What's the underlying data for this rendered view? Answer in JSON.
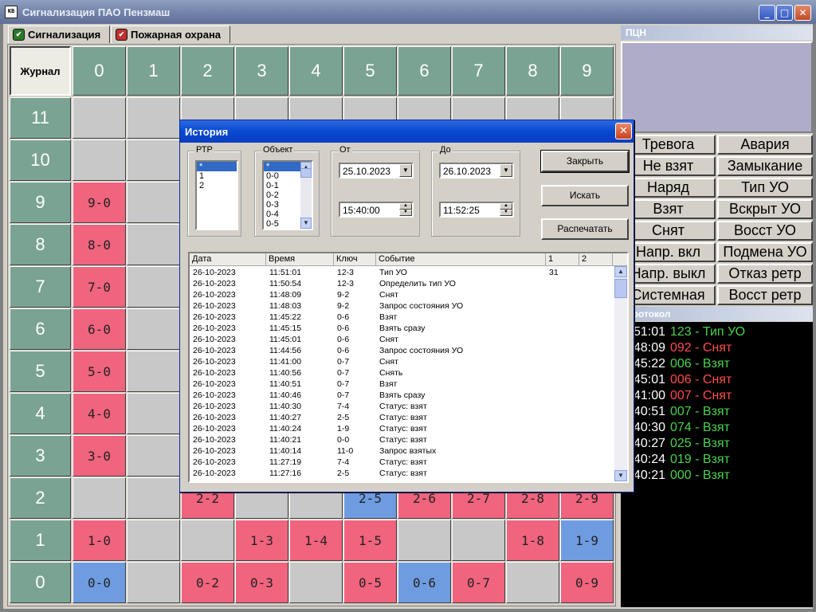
{
  "window": {
    "title": "Сигнализация ПАО Пензмаш",
    "icon_label": "KB"
  },
  "tabs": [
    {
      "label": "Сигнализация",
      "active": true
    },
    {
      "label": "Пожарная охрана",
      "active": false
    }
  ],
  "grid": {
    "corner_label": "Журнал",
    "col_headers": [
      "0",
      "1",
      "2",
      "3",
      "4",
      "5",
      "6",
      "7",
      "8",
      "9"
    ],
    "rows": [
      {
        "label": "11",
        "cells": [
          {
            "s": "gray",
            "t": ""
          },
          {
            "s": "gray",
            "t": ""
          },
          {
            "s": "gray",
            "t": ""
          },
          {
            "s": "gray",
            "t": ""
          },
          {
            "s": "gray",
            "t": ""
          },
          {
            "s": "gray",
            "t": ""
          },
          {
            "s": "gray",
            "t": ""
          },
          {
            "s": "gray",
            "t": ""
          },
          {
            "s": "gray",
            "t": ""
          },
          {
            "s": "gray",
            "t": ""
          }
        ]
      },
      {
        "label": "10",
        "cells": [
          {
            "s": "gray",
            "t": ""
          },
          {
            "s": "gray",
            "t": ""
          },
          {
            "s": "gray",
            "t": ""
          },
          {
            "s": "gray",
            "t": ""
          },
          {
            "s": "gray",
            "t": ""
          },
          {
            "s": "gray",
            "t": ""
          },
          {
            "s": "gray",
            "t": ""
          },
          {
            "s": "gray",
            "t": ""
          },
          {
            "s": "gray",
            "t": ""
          },
          {
            "s": "gray",
            "t": ""
          }
        ]
      },
      {
        "label": "9",
        "cells": [
          {
            "s": "red",
            "t": "9-0"
          },
          {
            "s": "gray",
            "t": ""
          },
          {
            "s": "gray",
            "t": ""
          },
          {
            "s": "gray",
            "t": ""
          },
          {
            "s": "gray",
            "t": ""
          },
          {
            "s": "gray",
            "t": ""
          },
          {
            "s": "gray",
            "t": ""
          },
          {
            "s": "gray",
            "t": ""
          },
          {
            "s": "gray",
            "t": ""
          },
          {
            "s": "gray",
            "t": ""
          }
        ]
      },
      {
        "label": "8",
        "cells": [
          {
            "s": "red",
            "t": "8-0"
          },
          {
            "s": "gray",
            "t": ""
          },
          {
            "s": "gray",
            "t": ""
          },
          {
            "s": "gray",
            "t": ""
          },
          {
            "s": "gray",
            "t": ""
          },
          {
            "s": "gray",
            "t": ""
          },
          {
            "s": "gray",
            "t": ""
          },
          {
            "s": "gray",
            "t": ""
          },
          {
            "s": "gray",
            "t": ""
          },
          {
            "s": "gray",
            "t": ""
          }
        ]
      },
      {
        "label": "7",
        "cells": [
          {
            "s": "red",
            "t": "7-0"
          },
          {
            "s": "gray",
            "t": ""
          },
          {
            "s": "gray",
            "t": ""
          },
          {
            "s": "gray",
            "t": ""
          },
          {
            "s": "gray",
            "t": ""
          },
          {
            "s": "gray",
            "t": ""
          },
          {
            "s": "gray",
            "t": ""
          },
          {
            "s": "gray",
            "t": ""
          },
          {
            "s": "gray",
            "t": ""
          },
          {
            "s": "gray",
            "t": ""
          }
        ]
      },
      {
        "label": "6",
        "cells": [
          {
            "s": "red",
            "t": "6-0"
          },
          {
            "s": "gray",
            "t": ""
          },
          {
            "s": "gray",
            "t": ""
          },
          {
            "s": "gray",
            "t": ""
          },
          {
            "s": "gray",
            "t": ""
          },
          {
            "s": "gray",
            "t": ""
          },
          {
            "s": "gray",
            "t": ""
          },
          {
            "s": "gray",
            "t": ""
          },
          {
            "s": "gray",
            "t": ""
          },
          {
            "s": "gray",
            "t": ""
          }
        ]
      },
      {
        "label": "5",
        "cells": [
          {
            "s": "red",
            "t": "5-0"
          },
          {
            "s": "gray",
            "t": ""
          },
          {
            "s": "gray",
            "t": ""
          },
          {
            "s": "gray",
            "t": ""
          },
          {
            "s": "gray",
            "t": ""
          },
          {
            "s": "gray",
            "t": ""
          },
          {
            "s": "gray",
            "t": ""
          },
          {
            "s": "gray",
            "t": ""
          },
          {
            "s": "gray",
            "t": ""
          },
          {
            "s": "gray",
            "t": ""
          }
        ]
      },
      {
        "label": "4",
        "cells": [
          {
            "s": "red",
            "t": "4-0"
          },
          {
            "s": "gray",
            "t": ""
          },
          {
            "s": "gray",
            "t": ""
          },
          {
            "s": "gray",
            "t": ""
          },
          {
            "s": "gray",
            "t": ""
          },
          {
            "s": "gray",
            "t": ""
          },
          {
            "s": "gray",
            "t": ""
          },
          {
            "s": "gray",
            "t": ""
          },
          {
            "s": "gray",
            "t": ""
          },
          {
            "s": "gray",
            "t": ""
          }
        ]
      },
      {
        "label": "3",
        "cells": [
          {
            "s": "red",
            "t": "3-0"
          },
          {
            "s": "gray",
            "t": ""
          },
          {
            "s": "gray",
            "t": ""
          },
          {
            "s": "gray",
            "t": ""
          },
          {
            "s": "gray",
            "t": ""
          },
          {
            "s": "gray",
            "t": ""
          },
          {
            "s": "gray",
            "t": ""
          },
          {
            "s": "gray",
            "t": ""
          },
          {
            "s": "gray",
            "t": ""
          },
          {
            "s": "gray",
            "t": ""
          }
        ]
      },
      {
        "label": "2",
        "cells": [
          {
            "s": "gray",
            "t": ""
          },
          {
            "s": "gray",
            "t": ""
          },
          {
            "s": "red",
            "t": "2-2"
          },
          {
            "s": "gray",
            "t": ""
          },
          {
            "s": "gray",
            "t": ""
          },
          {
            "s": "blue",
            "t": "2-5"
          },
          {
            "s": "red",
            "t": "2-6"
          },
          {
            "s": "red",
            "t": "2-7"
          },
          {
            "s": "red",
            "t": "2-8"
          },
          {
            "s": "red",
            "t": "2-9"
          }
        ]
      },
      {
        "label": "1",
        "cells": [
          {
            "s": "red",
            "t": "1-0"
          },
          {
            "s": "gray",
            "t": ""
          },
          {
            "s": "gray",
            "t": ""
          },
          {
            "s": "red",
            "t": "1-3"
          },
          {
            "s": "red",
            "t": "1-4"
          },
          {
            "s": "red",
            "t": "1-5"
          },
          {
            "s": "gray",
            "t": ""
          },
          {
            "s": "gray",
            "t": ""
          },
          {
            "s": "red",
            "t": "1-8"
          },
          {
            "s": "blue",
            "t": "1-9"
          }
        ]
      },
      {
        "label": "0",
        "cells": [
          {
            "s": "blue",
            "t": "0-0"
          },
          {
            "s": "gray",
            "t": ""
          },
          {
            "s": "red",
            "t": "0-2"
          },
          {
            "s": "red",
            "t": "0-3"
          },
          {
            "s": "gray",
            "t": ""
          },
          {
            "s": "red",
            "t": "0-5"
          },
          {
            "s": "blue",
            "t": "0-6"
          },
          {
            "s": "red",
            "t": "0-7"
          },
          {
            "s": "gray",
            "t": ""
          },
          {
            "s": "red",
            "t": "0-9"
          }
        ]
      }
    ]
  },
  "pcn": {
    "title": "ПЦН"
  },
  "status_buttons": [
    "Тревога",
    "Авария",
    "Не взят",
    "Замыкание",
    "Наряд",
    "Тип УО",
    "Взят",
    "Вскрыт УО",
    "Снят",
    "Восст УО",
    "Напр. вкл",
    "Подмена УО",
    "Напр. выкл",
    "Отказ ретр",
    "Системная",
    "Восст ретр"
  ],
  "protocol": {
    "title": "Протокол",
    "lines": [
      {
        "time": "11:51:01",
        "text": "123 - Тип УО",
        "color": "green"
      },
      {
        "time": "11:48:09",
        "text": "092 - Снят",
        "color": "red"
      },
      {
        "time": "11:45:22",
        "text": "006 - Взят",
        "color": "green"
      },
      {
        "time": "11:45:01",
        "text": "006 - Снят",
        "color": "red"
      },
      {
        "time": "11:41:00",
        "text": "007 - Снят",
        "color": "red"
      },
      {
        "time": "11:40:51",
        "text": "007 - Взят",
        "color": "green"
      },
      {
        "time": "11:40:30",
        "text": "074 - Взят",
        "color": "green"
      },
      {
        "time": "11:40:27",
        "text": "025 - Взят",
        "color": "green"
      },
      {
        "time": "11:40:24",
        "text": "019 - Взят",
        "color": "green"
      },
      {
        "time": "11:40:21",
        "text": "000 - Взят",
        "color": "green"
      }
    ]
  },
  "dialog": {
    "title": "История",
    "rtr": {
      "label": "РТР",
      "items": [
        "*",
        "1",
        "2"
      ],
      "selected": 0
    },
    "object": {
      "label": "Объект",
      "items": [
        "*",
        "0-0",
        "0-1",
        "0-2",
        "0-3",
        "0-4",
        "0-5"
      ],
      "selected": 0
    },
    "from": {
      "label": "От",
      "date": "25.10.2023",
      "time": "15:40:00"
    },
    "to": {
      "label": "До",
      "date": "26.10.2023",
      "time": "11:52:25"
    },
    "buttons": {
      "close": "Закрыть",
      "search": "Искать",
      "print": "Распечатать"
    },
    "columns": [
      "Дата",
      "Время",
      "Ключ",
      "Событие",
      "1",
      "2"
    ],
    "rows": [
      [
        "26-10-2023",
        "11:51:01",
        "12-3",
        "Тип УО",
        "31",
        ""
      ],
      [
        "26-10-2023",
        "11:50:54",
        "12-3",
        "Определить тип УО",
        "",
        ""
      ],
      [
        "26-10-2023",
        "11:48:09",
        "9-2",
        "Снят",
        "",
        ""
      ],
      [
        "26-10-2023",
        "11:48:03",
        "9-2",
        "Запрос состояния УО",
        "",
        ""
      ],
      [
        "26-10-2023",
        "11:45:22",
        "0-6",
        "Взят",
        "",
        ""
      ],
      [
        "26-10-2023",
        "11:45:15",
        "0-6",
        "Взять сразу",
        "",
        ""
      ],
      [
        "26-10-2023",
        "11:45:01",
        "0-6",
        "Снят",
        "",
        ""
      ],
      [
        "26-10-2023",
        "11:44:56",
        "0-6",
        "Запрос состояния УО",
        "",
        ""
      ],
      [
        "26-10-2023",
        "11:41:00",
        "0-7",
        "Снят",
        "",
        ""
      ],
      [
        "26-10-2023",
        "11:40:56",
        "0-7",
        "Снять",
        "",
        ""
      ],
      [
        "26-10-2023",
        "11:40:51",
        "0-7",
        "Взят",
        "",
        ""
      ],
      [
        "26-10-2023",
        "11:40:46",
        "0-7",
        "Взять сразу",
        "",
        ""
      ],
      [
        "26-10-2023",
        "11:40:30",
        "7-4",
        "Статус: взят",
        "",
        ""
      ],
      [
        "26-10-2023",
        "11:40:27",
        "2-5",
        "Статус: взят",
        "",
        ""
      ],
      [
        "26-10-2023",
        "11:40:24",
        "1-9",
        "Статус: взят",
        "",
        ""
      ],
      [
        "26-10-2023",
        "11:40:21",
        "0-0",
        "Статус: взят",
        "",
        ""
      ],
      [
        "26-10-2023",
        "11:40:14",
        "11-0",
        "Запрос взятых",
        "",
        ""
      ],
      [
        "26-10-2023",
        "11:27:19",
        "7-4",
        "Статус: взят",
        "",
        ""
      ],
      [
        "26-10-2023",
        "11:27:16",
        "2-5",
        "Статус: взят",
        "",
        ""
      ]
    ]
  }
}
